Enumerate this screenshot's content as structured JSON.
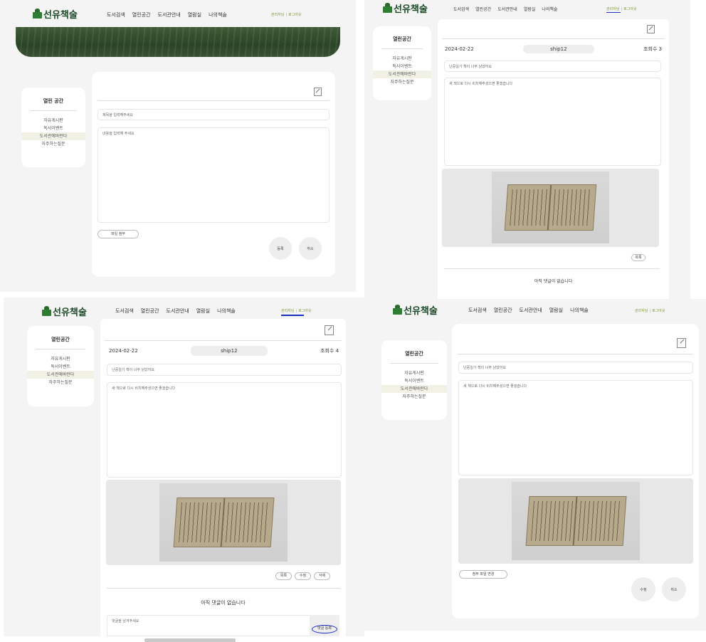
{
  "brand": {
    "name": "선유책술"
  },
  "nav": [
    "도서검색",
    "열린공간",
    "도서관안내",
    "열람실",
    "나의책술"
  ],
  "util": {
    "user": "관리자님",
    "logout": "로그아웃"
  },
  "sidebar": {
    "title_p1": "열린 공간",
    "title": "열린공간",
    "items": [
      "자유게시판",
      "독서이벤트",
      "도서관에바란다",
      "자주하는질문"
    ],
    "active_index": 2
  },
  "write_form": {
    "title_placeholder": "제목을 입력해주세요",
    "content_placeholder": "내용을 입력해 주세요",
    "attach_label": "파일 첨부",
    "submit_label": "등록",
    "cancel_label": "취소"
  },
  "post": {
    "date": "2024-02-22",
    "author": "ship12",
    "views_p2": "조회수 3",
    "views_p3": "조회수 4",
    "title": "난중일기 책이 너무 낡았어요",
    "content": "새 책으로 다시 비치해주셨으면 좋겠습니다"
  },
  "post_actions": {
    "list": "목록",
    "edit": "수정",
    "delete": "삭제"
  },
  "comments": {
    "empty": "아직 댓글이 없습니다",
    "placeholder": "댓글을 남겨주세요",
    "submit": "댓글 등록"
  },
  "edit_form": {
    "change_attach": "첨부 파일 변경",
    "save": "수정",
    "cancel": "취소"
  },
  "colors": {
    "brand": "#1e4a2a",
    "accent": "#7a9a3a",
    "highlight": "#1b2fbf"
  }
}
